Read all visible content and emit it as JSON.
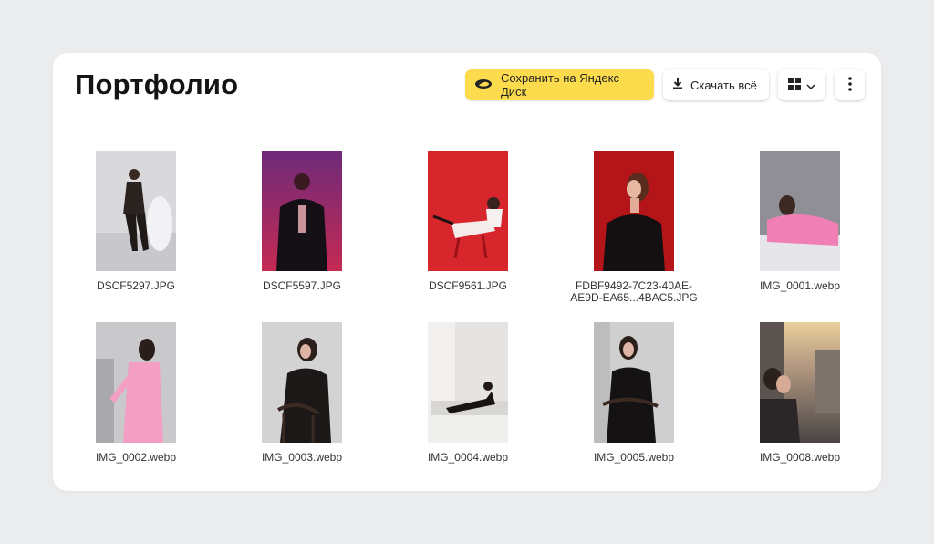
{
  "title": "Портфолио",
  "toolbar": {
    "save_label": "Сохранить на Яндекс Диск",
    "download_label": "Скачать всё"
  },
  "files": [
    {
      "name": "DSCF5297.JPG",
      "bg": "#d9d9dc"
    },
    {
      "name": "DSCF5597.JPG",
      "bg": "#b0284f"
    },
    {
      "name": "DSCF9561.JPG",
      "bg": "#d8262d"
    },
    {
      "name": "FDBF9492-7C23-40AE-AE9D-EA65...4BAC5.JPG",
      "bg": "#b31519"
    },
    {
      "name": "IMG_0001.webp",
      "bg": "#9a9a9f"
    },
    {
      "name": "IMG_0002.webp",
      "bg": "#c9c9cc"
    },
    {
      "name": "IMG_0003.webp",
      "bg": "#d4d3d3"
    },
    {
      "name": "IMG_0004.webp",
      "bg": "#e5e4e2"
    },
    {
      "name": "IMG_0005.webp",
      "bg": "#cfcfd0"
    },
    {
      "name": "IMG_0008.webp",
      "bg": "#8f8a86"
    }
  ],
  "icons": {
    "save": "yandex-disk-icon",
    "download": "download-icon",
    "view": "grid-view-icon",
    "chevron": "chevron-down-icon",
    "more": "more-vertical-icon"
  }
}
